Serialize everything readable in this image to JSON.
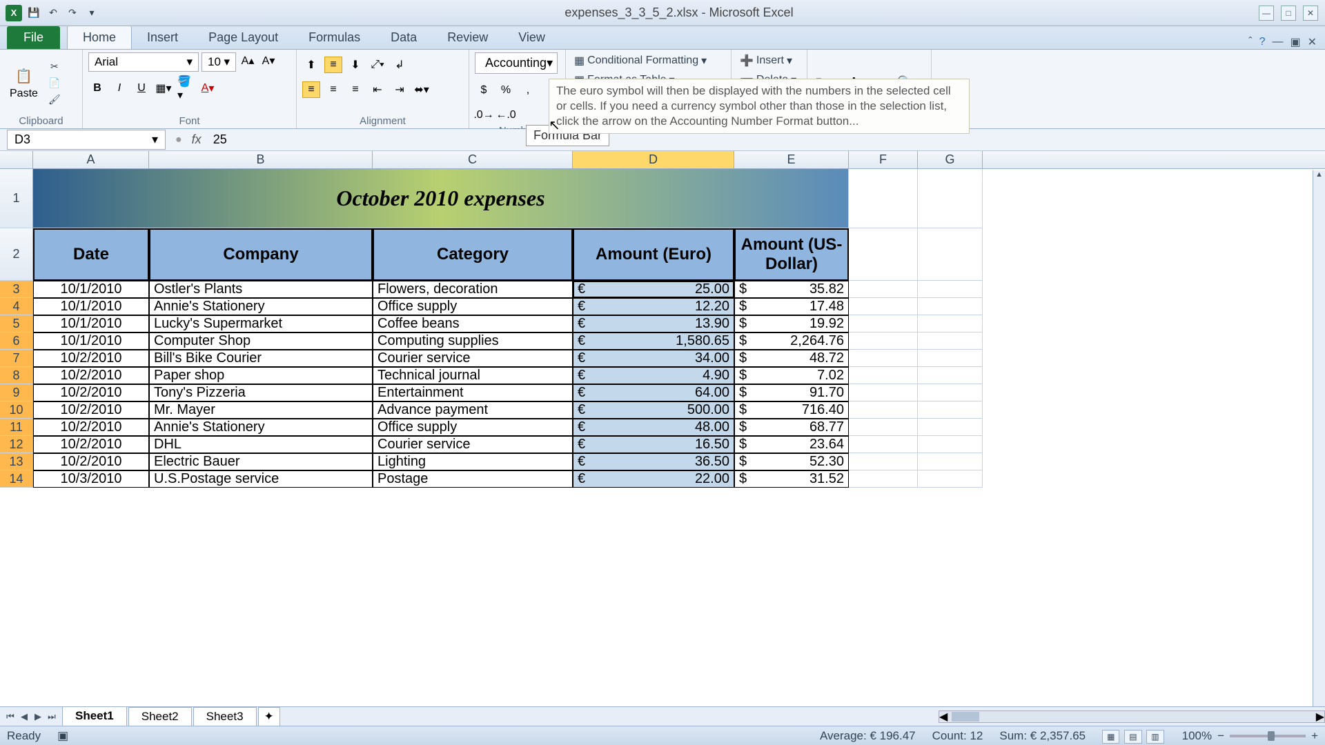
{
  "app": {
    "title": "expenses_3_3_5_2.xlsx - Microsoft Excel"
  },
  "qat": {
    "save": "💾",
    "undo": "↶",
    "redo": "↷"
  },
  "tabs": {
    "file": "File",
    "home": "Home",
    "insert": "Insert",
    "pagelayout": "Page Layout",
    "formulas": "Formulas",
    "data": "Data",
    "review": "Review",
    "view": "View"
  },
  "ribbon": {
    "clipboard": {
      "label": "Clipboard",
      "paste": "Paste"
    },
    "font": {
      "label": "Font",
      "name": "Arial",
      "size": "10",
      "bold": "B",
      "italic": "I",
      "underline": "U"
    },
    "alignment": {
      "label": "Alignment"
    },
    "number": {
      "label": "Number",
      "format": "Accounting",
      "currency": "$",
      "percent": "%",
      "comma": ",",
      "incdec": ".00",
      "decdec": ".0"
    },
    "styles": {
      "cond": "Conditional Formatting",
      "table": "Format as Table"
    },
    "cells": {
      "insert": "Insert",
      "delete": "Delete"
    },
    "editing": {
      "sort": "Sort &",
      "find": "Find &"
    }
  },
  "tooltip": "The euro symbol will then be displayed with the numbers in the selected cell or cells. If you need a currency symbol other than those in the selection list, click the arrow on the Accounting Number Format button...",
  "formulabar": {
    "namebox": "D3",
    "fx": "fx",
    "value": "25",
    "tip": "Formula Bar"
  },
  "columns": [
    "A",
    "B",
    "C",
    "D",
    "E",
    "F",
    "G"
  ],
  "sheet": {
    "title": "October 2010 expenses",
    "headers": {
      "date": "Date",
      "company": "Company",
      "category": "Category",
      "euro": "Amount (Euro)",
      "usd": "Amount (US-Dollar)"
    },
    "rows": [
      {
        "r": "3",
        "date": "10/1/2010",
        "company": "Ostler's Plants",
        "category": "Flowers, decoration",
        "euro": "25.00",
        "usd": "35.82"
      },
      {
        "r": "4",
        "date": "10/1/2010",
        "company": "Annie's Stationery",
        "category": "Office supply",
        "euro": "12.20",
        "usd": "17.48"
      },
      {
        "r": "5",
        "date": "10/1/2010",
        "company": "Lucky's Supermarket",
        "category": "Coffee beans",
        "euro": "13.90",
        "usd": "19.92"
      },
      {
        "r": "6",
        "date": "10/1/2010",
        "company": "Computer Shop",
        "category": "Computing supplies",
        "euro": "1,580.65",
        "usd": "2,264.76"
      },
      {
        "r": "7",
        "date": "10/2/2010",
        "company": "Bill's Bike Courier",
        "category": "Courier service",
        "euro": "34.00",
        "usd": "48.72"
      },
      {
        "r": "8",
        "date": "10/2/2010",
        "company": "Paper shop",
        "category": "Technical journal",
        "euro": "4.90",
        "usd": "7.02"
      },
      {
        "r": "9",
        "date": "10/2/2010",
        "company": "Tony's Pizzeria",
        "category": "Entertainment",
        "euro": "64.00",
        "usd": "91.70"
      },
      {
        "r": "10",
        "date": "10/2/2010",
        "company": "Mr. Mayer",
        "category": "Advance payment",
        "euro": "500.00",
        "usd": "716.40"
      },
      {
        "r": "11",
        "date": "10/2/2010",
        "company": "Annie's Stationery",
        "category": "Office supply",
        "euro": "48.00",
        "usd": "68.77"
      },
      {
        "r": "12",
        "date": "10/2/2010",
        "company": "DHL",
        "category": "Courier service",
        "euro": "16.50",
        "usd": "23.64"
      },
      {
        "r": "13",
        "date": "10/2/2010",
        "company": "Electric Bauer",
        "category": "Lighting",
        "euro": "36.50",
        "usd": "52.30"
      },
      {
        "r": "14",
        "date": "10/3/2010",
        "company": "U.S.Postage service",
        "category": "Postage",
        "euro": "22.00",
        "usd": "31.52"
      }
    ]
  },
  "sheettabs": [
    "Sheet1",
    "Sheet2",
    "Sheet3"
  ],
  "status": {
    "ready": "Ready",
    "avg": "Average:  € 196.47",
    "count": "Count: 12",
    "sum": "Sum:  € 2,357.65",
    "zoom": "100%"
  }
}
